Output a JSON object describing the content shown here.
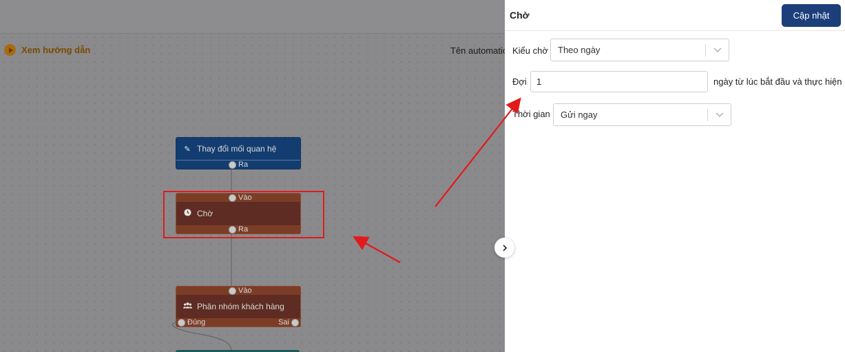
{
  "canvas": {
    "guide_label": "Xem hướng dẫn",
    "automation_name_label": "Tên automatic",
    "nodes": {
      "change_relation": {
        "title": "Thay đổi mối quan hệ",
        "out_label": "Ra"
      },
      "wait": {
        "in_label": "Vào",
        "title": "Chờ",
        "out_label": "Ra"
      },
      "group_customers": {
        "in_label": "Vào",
        "title": "Phân nhóm khách hàng",
        "true_label": "Đúng",
        "false_label": "Sai"
      }
    }
  },
  "panel": {
    "title": "Chờ",
    "update_button": "Cập nhật",
    "wait_type": {
      "label": "Kiểu chờ",
      "value": "Theo ngày"
    },
    "wait_amount": {
      "label": "Đợi",
      "value": "1",
      "suffix": "ngày từ lúc bắt đầu và thực hiện"
    },
    "time": {
      "label": "Thời gian",
      "value": "Gửi ngay"
    }
  },
  "colors": {
    "accent": "#1c3f7c",
    "highlight": "#e21a1a"
  }
}
